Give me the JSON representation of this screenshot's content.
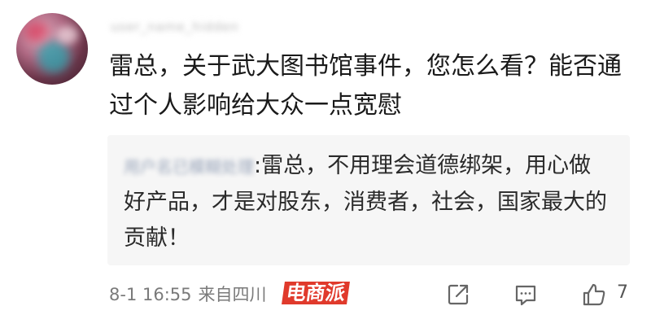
{
  "comment": {
    "author": "user_name_hidden",
    "text": "雷总，关于武大图书馆事件，您怎么看？能否通过个人影响给大众一点宽慰"
  },
  "reply": {
    "author": "用户名已模糊处理",
    "separator": ":",
    "text": "雷总，不用理会道德绑架，用心做好产品，才是对股东，消费者，社会，国家最大的贡献！"
  },
  "footer": {
    "timestamp": "8-1 16:55",
    "location": "来自四川",
    "like_count": "7"
  },
  "watermark": {
    "text": "电商派",
    "color": "#e03a2c"
  },
  "icons": {
    "share": "share-icon",
    "comment": "comment-icon",
    "like": "thumbs-up-icon"
  }
}
